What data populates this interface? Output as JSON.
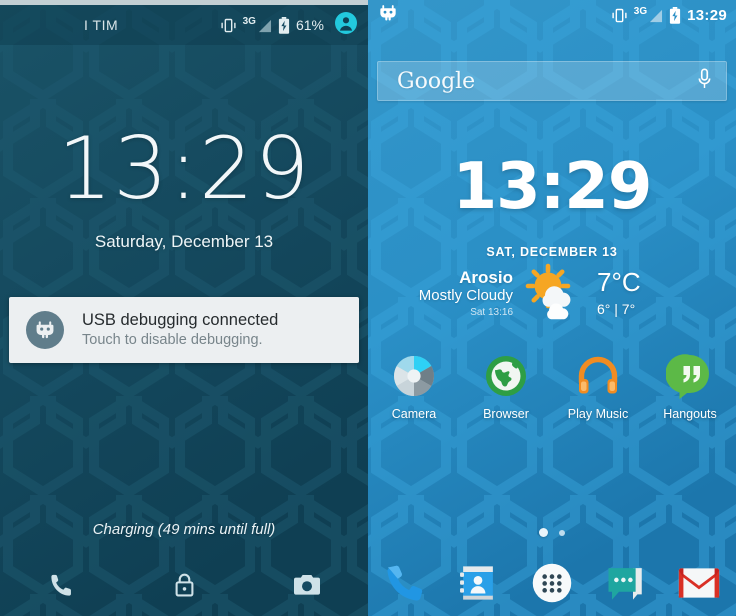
{
  "lockscreen": {
    "statusbar": {
      "carrier": "I TIM",
      "network_type": "3G",
      "battery_percent": "61%",
      "icons": [
        "vibrate-icon",
        "signal-icon",
        "battery-charging-icon",
        "user-avatar-icon"
      ]
    },
    "clock": "13:29",
    "date": "Saturday, December 13",
    "notification": {
      "title": "USB debugging connected",
      "subtitle": "Touch to disable debugging.",
      "icon": "cyanogenmod-robot-icon"
    },
    "charging_status": "Charging (49 mins until full)",
    "shortcuts": [
      {
        "name": "phone-icon"
      },
      {
        "name": "lock-icon"
      },
      {
        "name": "camera-icon"
      }
    ],
    "colors": {
      "background": "#154a61",
      "card": "#eceff1",
      "accent": "#1fc8db"
    }
  },
  "homescreen": {
    "statusbar": {
      "logo": "cyanogenmod-robot-icon",
      "network_type": "3G",
      "time": "13:29",
      "icons": [
        "vibrate-icon",
        "signal-icon",
        "battery-charging-icon"
      ]
    },
    "search": {
      "brand": "Google",
      "placeholder": "Google",
      "mic_icon": "microphone-icon"
    },
    "clock": "13:29",
    "weather": {
      "date": "SAT, DECEMBER 13",
      "city": "Arosio",
      "condition": "Mostly Cloudy",
      "updated": "Sat 13:16",
      "temperature": "7°C",
      "high_low": "6° | 7°",
      "icon": "sun-behind-cloud-icon"
    },
    "apps": [
      {
        "label": "Camera",
        "icon": "camera-aperture-icon"
      },
      {
        "label": "Browser",
        "icon": "globe-browser-icon"
      },
      {
        "label": "Play Music",
        "icon": "headphones-icon"
      },
      {
        "label": "Hangouts",
        "icon": "quote-bubble-icon"
      }
    ],
    "page_indicator": {
      "total": 2,
      "active": 1
    },
    "dock": [
      {
        "name": "phone-dock-icon"
      },
      {
        "name": "contacts-dock-icon"
      },
      {
        "name": "app-drawer-icon"
      },
      {
        "name": "messaging-dock-icon"
      },
      {
        "name": "gmail-dock-icon"
      }
    ],
    "colors": {
      "background": "#2b90c6",
      "accent": "#ffffff"
    }
  }
}
